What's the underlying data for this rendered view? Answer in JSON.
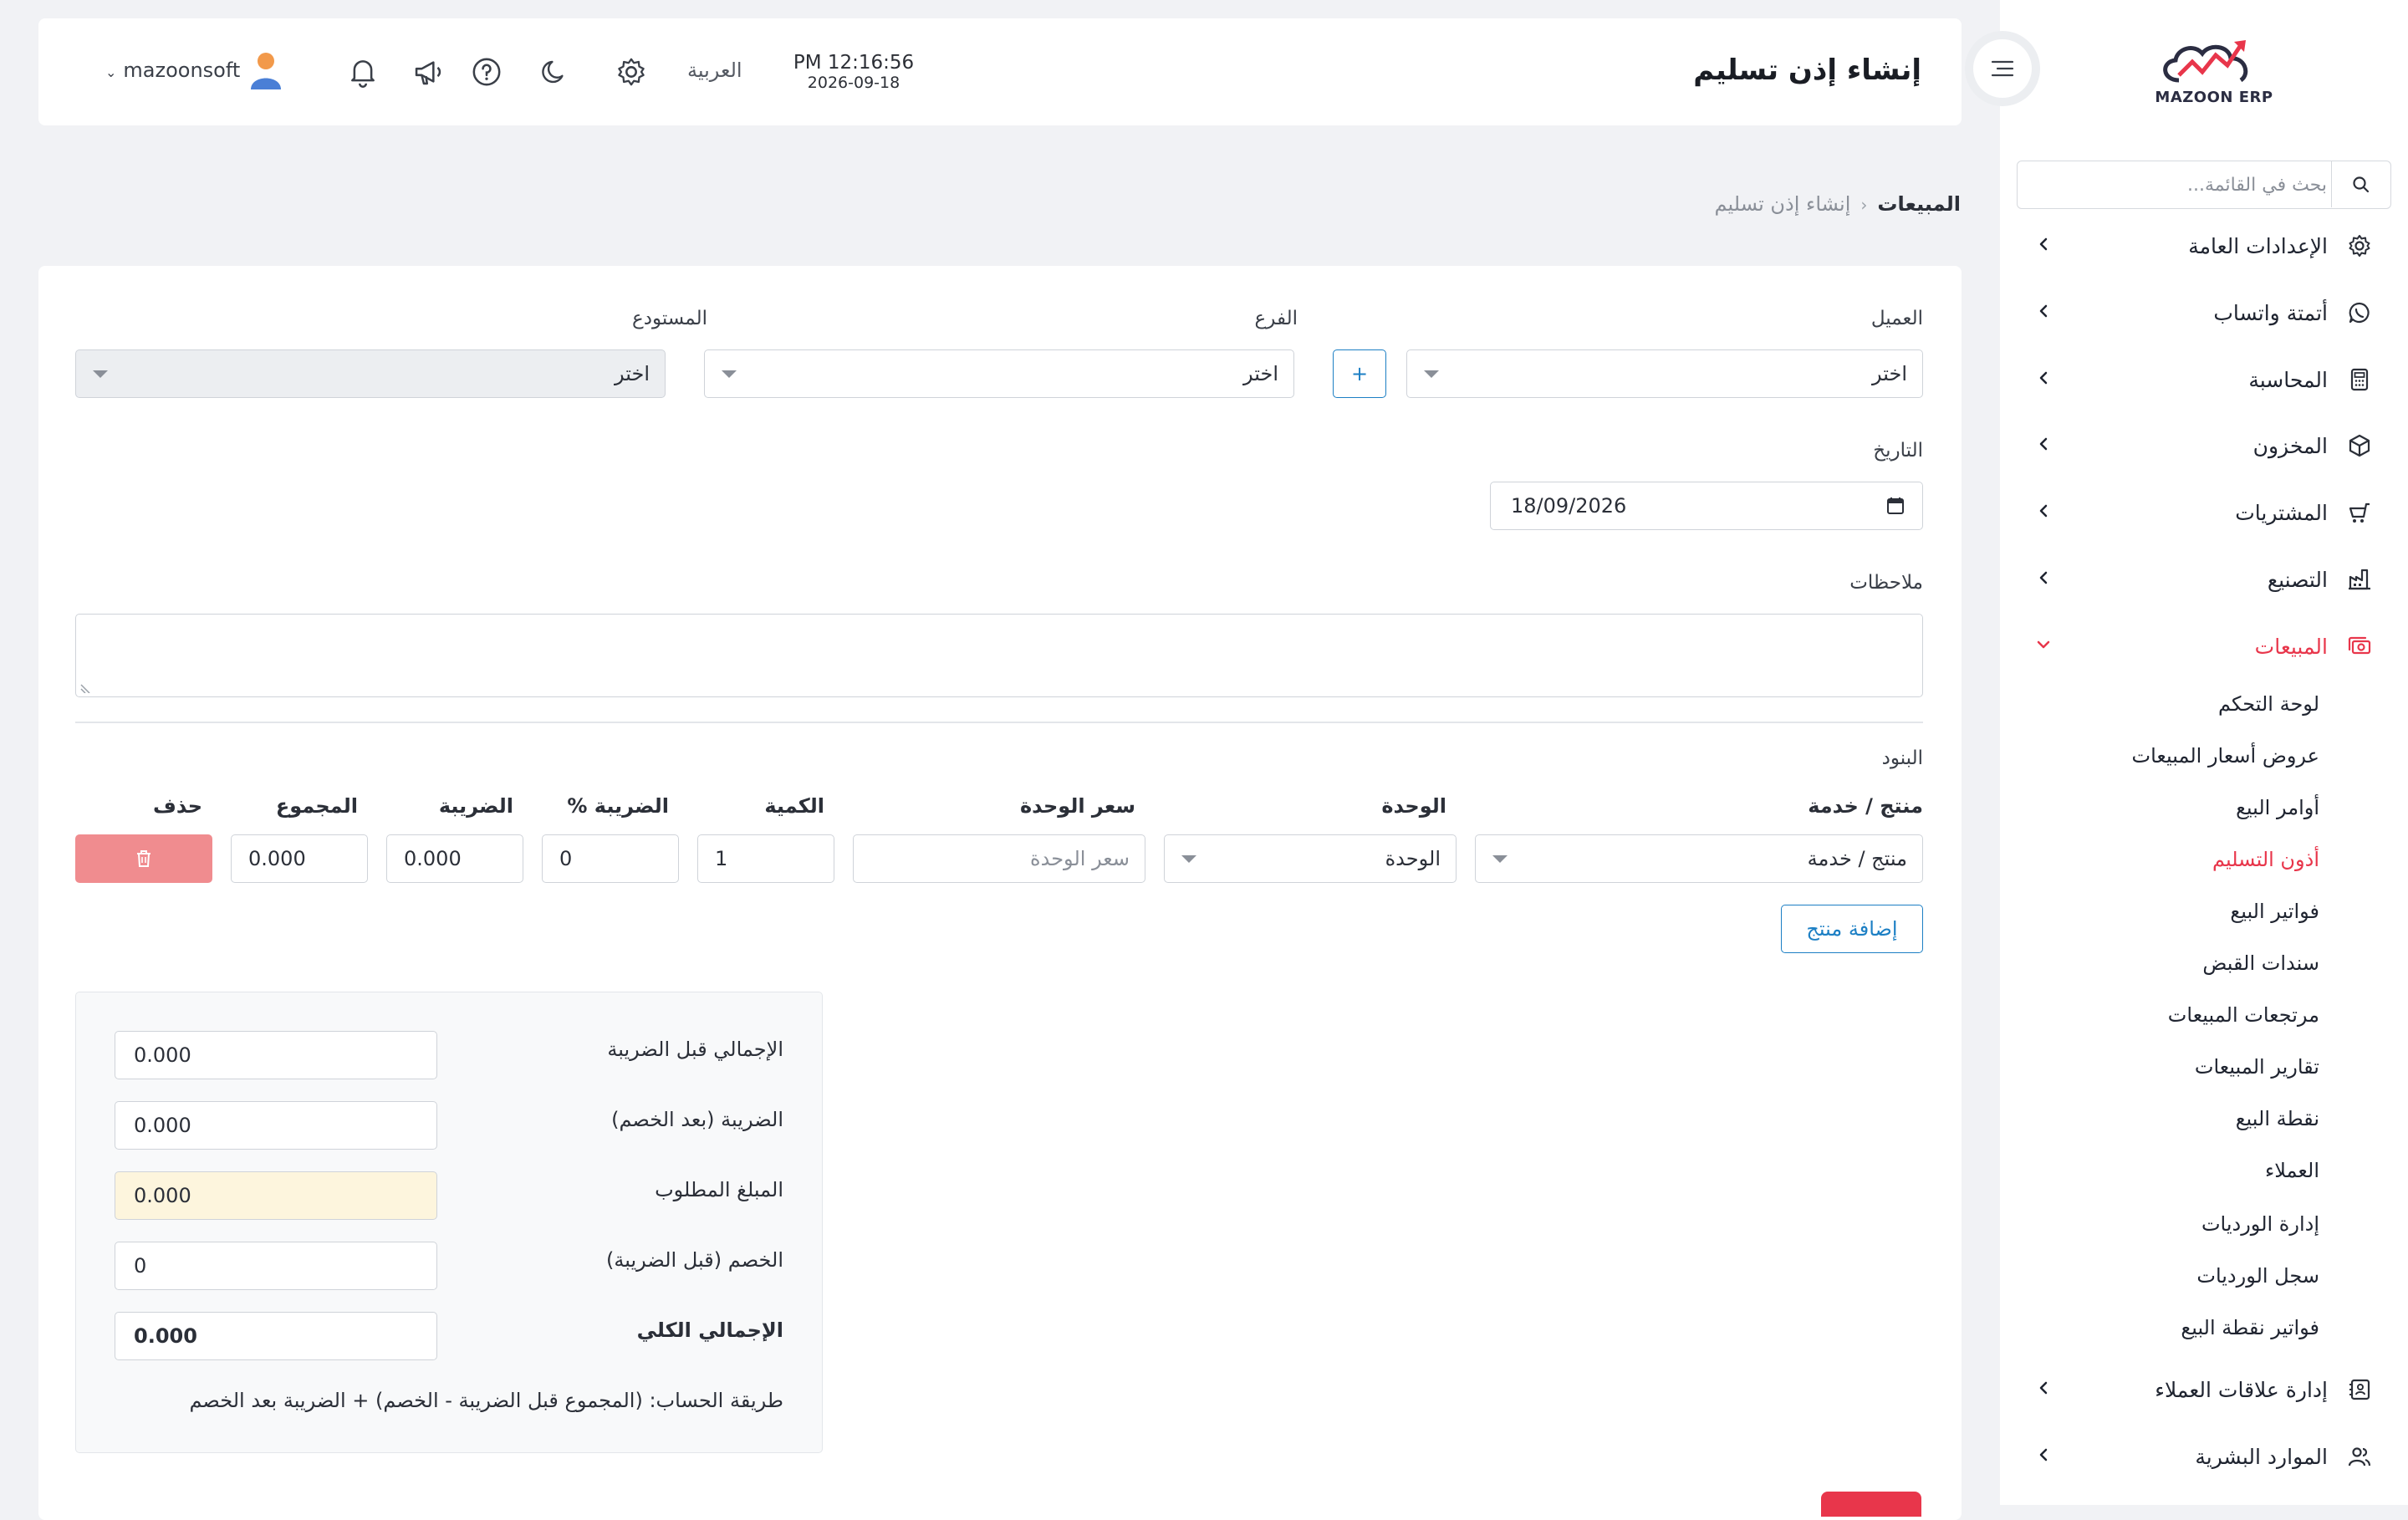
{
  "app": {
    "logo_text": "MAZOON ERP",
    "accent_color": "#e8364b",
    "link_color": "#1c7fc4"
  },
  "sidebar": {
    "search_placeholder": "بحث في القائمة...",
    "items": [
      {
        "label": "الإعدادات العامة",
        "icon": "gear-icon"
      },
      {
        "label": "أتمتة واتساب",
        "icon": "whatsapp-icon"
      },
      {
        "label": "المحاسبة",
        "icon": "calculator-icon"
      },
      {
        "label": "المخزون",
        "icon": "box-icon"
      },
      {
        "label": "المشتريات",
        "icon": "cart-icon"
      },
      {
        "label": "التصنيع",
        "icon": "factory-icon"
      },
      {
        "label": "المبيعات",
        "icon": "cash-icon",
        "expanded": true
      },
      {
        "label": "إدارة علاقات العملاء",
        "icon": "contacts-icon"
      },
      {
        "label": "الموارد البشرية",
        "icon": "users-icon"
      }
    ],
    "sales_sub": [
      "لوحة التحكم",
      "عروض أسعار المبيعات",
      "أوامر البيع",
      "أذون التسليم",
      "فواتير البيع",
      "سندات القبض",
      "مرتجعات المبيعات",
      "تقارير المبيعات",
      "نقطة البيع",
      "العملاء",
      "إدارة الورديات",
      "سجل الورديات",
      "فواتير نقطة البيع"
    ],
    "active_sub": "أذون التسليم"
  },
  "header": {
    "title": "إنشاء إذن تسليم",
    "time": "PM 12:16:56",
    "date": "2026-09-18",
    "language": "العربية",
    "username": "mazoonsoft"
  },
  "breadcrumb": {
    "parent": "المبيعات",
    "current": "إنشاء إذن تسليم"
  },
  "form": {
    "customer_label": "العميل",
    "customer_value": "اختر",
    "add_button": "+",
    "branch_label": "الفرع",
    "branch_value": "اختر",
    "warehouse_label": "المستودع",
    "warehouse_value": "اختر",
    "date_label": "التاريخ",
    "date_value": "18/09/2026",
    "notes_label": "ملاحظات",
    "notes_value": ""
  },
  "items": {
    "section_label": "البنود",
    "columns": [
      "منتج / خدمة",
      "الوحدة",
      "سعر الوحدة",
      "الكمية",
      "الضريبة %",
      "الضريبة",
      "المجموع",
      "حذف"
    ],
    "row": {
      "product_placeholder": "منتج / خدمة",
      "unit_placeholder": "الوحدة",
      "price_placeholder": "سعر الوحدة",
      "quantity": "1",
      "tax_percent": "0",
      "tax": "0.000",
      "total": "0.000"
    },
    "add_product_button": "إضافة منتج"
  },
  "summary": {
    "subtotal_label": "الإجمالي قبل الضريبة",
    "subtotal_value": "0.000",
    "tax_label": "الضريبة (بعد الخصم)",
    "tax_value": "0.000",
    "due_label": "المبلغ المطلوب",
    "due_value": "0.000",
    "discount_label": "الخصم (قبل الضريبة)",
    "discount_value": "0",
    "grand_total_label": "الإجمالي الكلي",
    "grand_total_value": "0.000",
    "formula": "طريقة الحساب: (المجموع قبل الضريبة - الخصم) + الضريبة بعد الخصم"
  }
}
